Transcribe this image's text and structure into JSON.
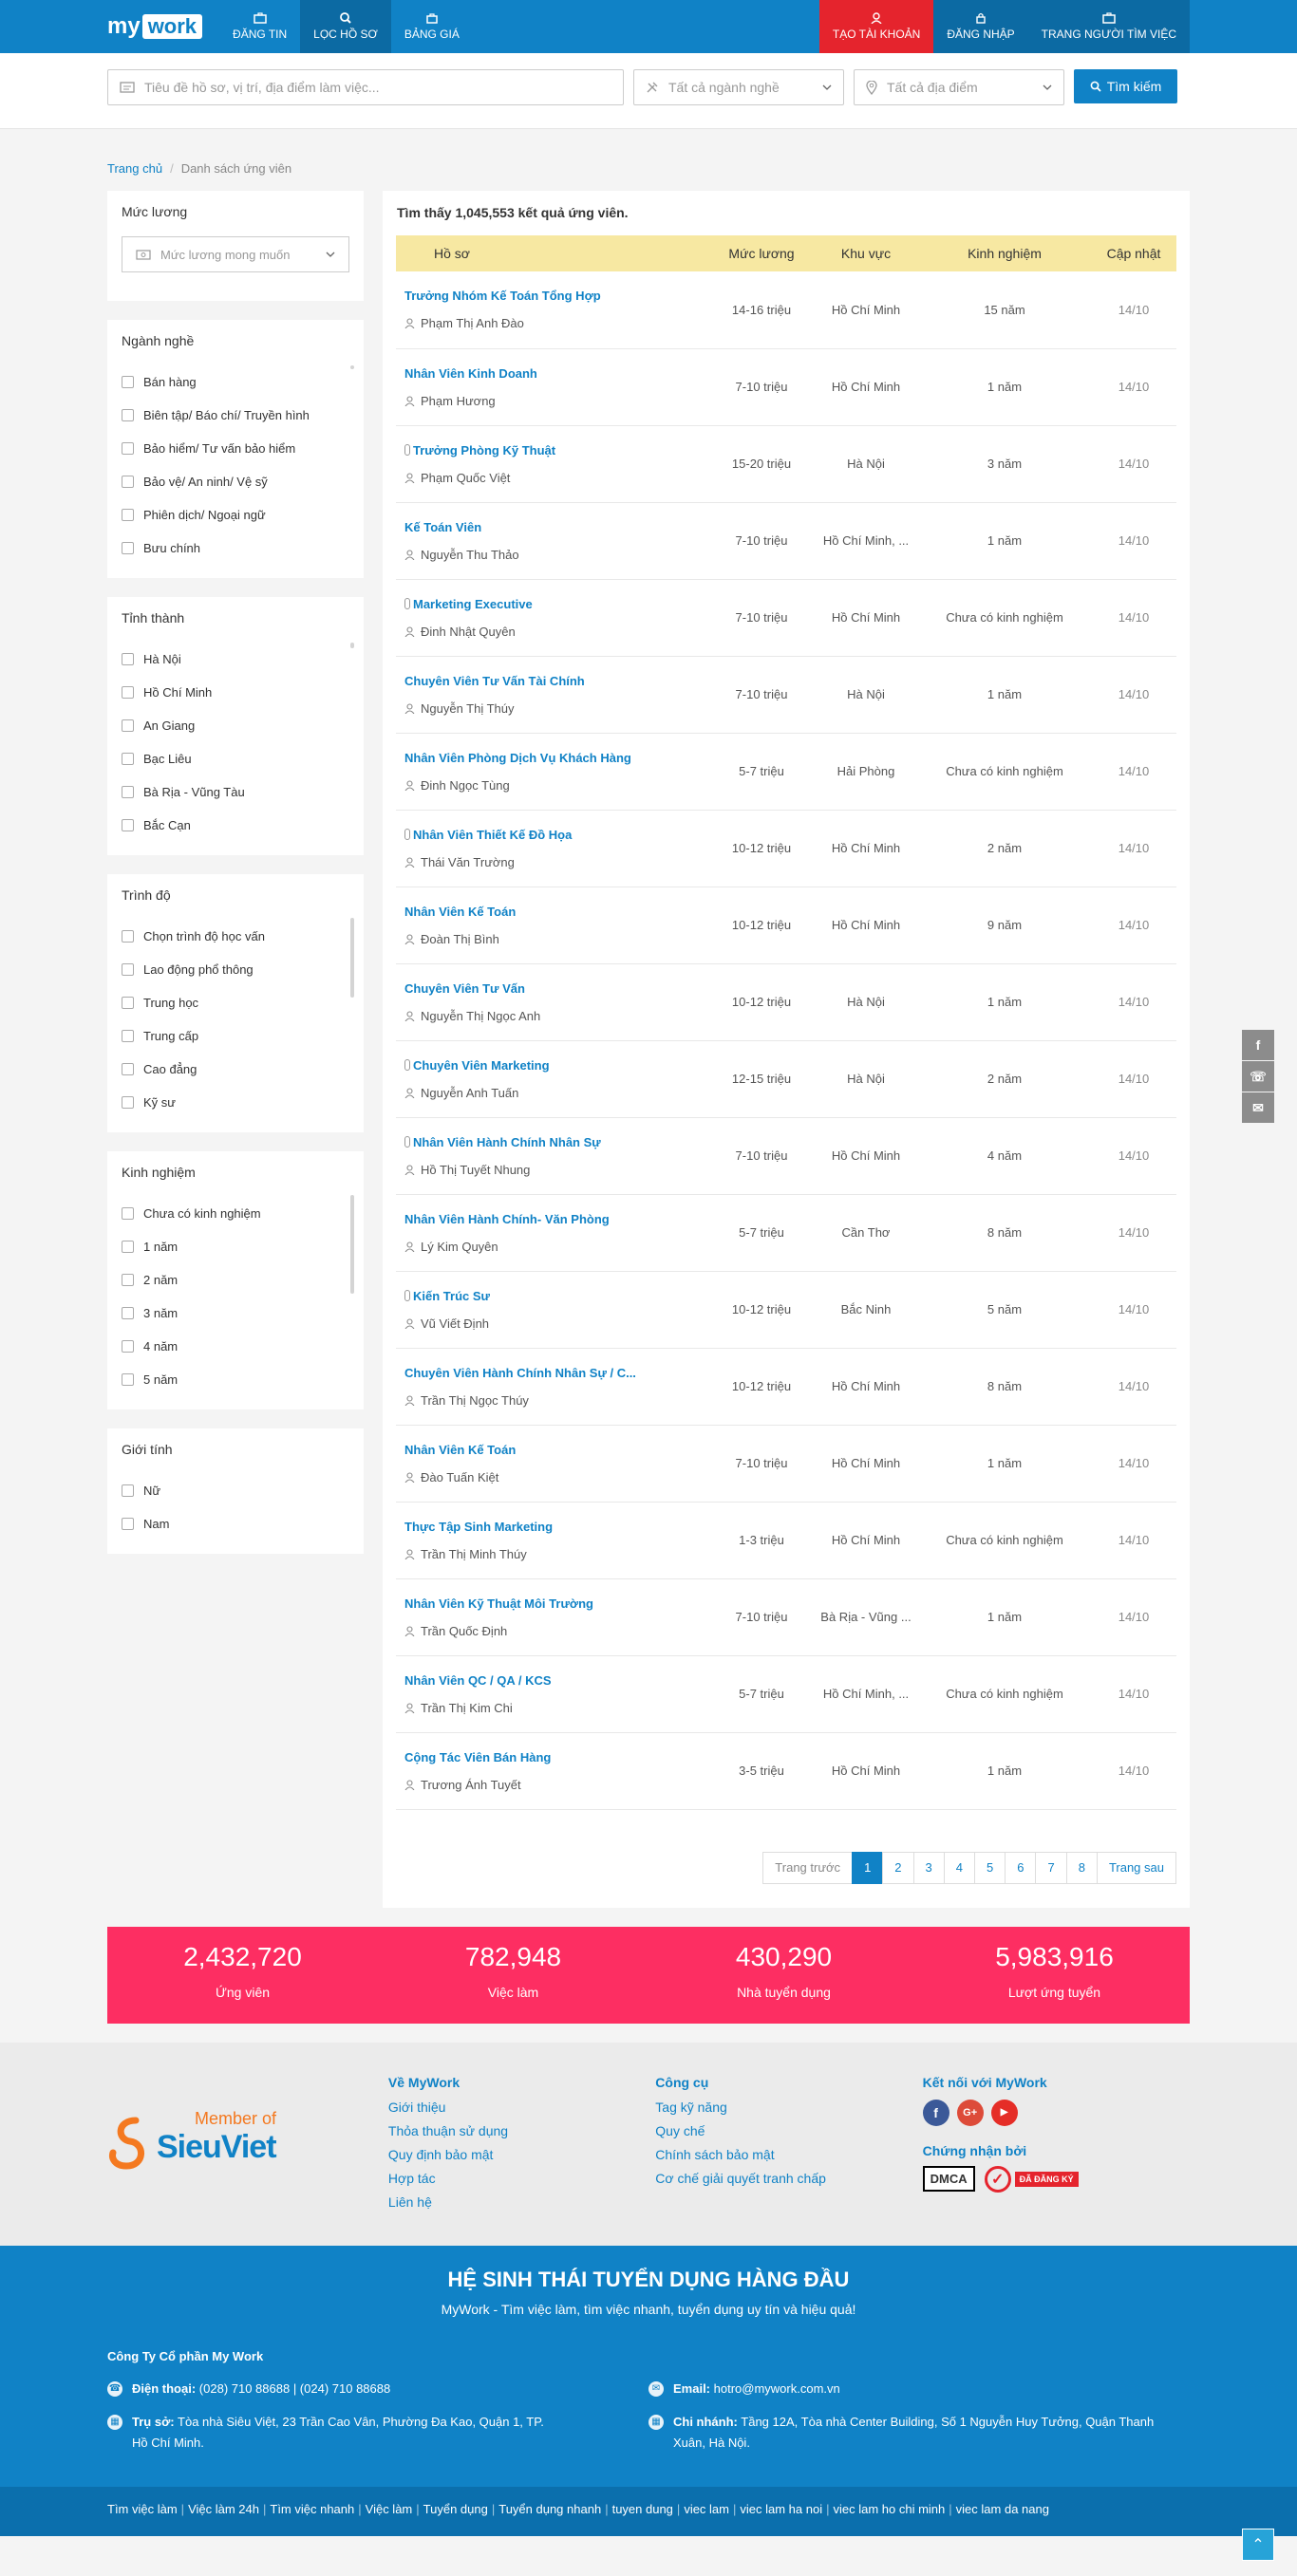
{
  "nav": {
    "logo_my": "my",
    "logo_work": "work",
    "items": [
      "ĐĂNG TIN",
      "LỌC HỒ SƠ",
      "BẢNG GIÁ"
    ],
    "right": [
      "TẠO TÀI KHOẢN",
      "ĐĂNG NHẬP",
      "TRANG NGƯỜI TÌM VIỆC"
    ]
  },
  "search": {
    "keyword_placeholder": "Tiêu đề hồ sơ, vị trí, địa điểm làm việc...",
    "industry": "Tất cả ngành nghề",
    "location": "Tất cả địa điểm",
    "button": "Tìm kiếm"
  },
  "breadcrumb": {
    "home": "Trang chủ",
    "sep": "/",
    "current": "Danh sách ứng viên"
  },
  "sidebar": {
    "salary": {
      "title": "Mức lương",
      "placeholder": "Mức lương mong muốn"
    },
    "industry": {
      "title": "Ngành nghề",
      "items": [
        "Bán hàng",
        "Biên tập/ Báo chí/ Truyền hình",
        "Bảo hiểm/ Tư vấn bảo hiểm",
        "Bảo vệ/ An ninh/ Vệ sỹ",
        "Phiên dịch/ Ngoại ngữ",
        "Bưu chính"
      ]
    },
    "province": {
      "title": "Tỉnh thành",
      "items": [
        "Hà Nội",
        "Hồ Chí Minh",
        "An Giang",
        "Bạc Liêu",
        "Bà Rịa - Vũng Tàu",
        "Bắc Cạn"
      ]
    },
    "level": {
      "title": "Trình độ",
      "items": [
        "Chọn trình độ học vấn",
        "Lao động phổ thông",
        "Trung học",
        "Trung cấp",
        "Cao đẳng",
        "Kỹ sư"
      ]
    },
    "experience": {
      "title": "Kinh nghiệm",
      "items": [
        "Chưa có kinh nghiệm",
        "1 năm",
        "2 năm",
        "3 năm",
        "4 năm",
        "5 năm"
      ]
    },
    "gender": {
      "title": "Giới tính",
      "items": [
        "Nữ",
        "Nam"
      ]
    }
  },
  "results": {
    "found": "Tìm thấy 1,045,553 kết quả ứng viên.",
    "headers": [
      "Hồ sơ",
      "Mức lương",
      "Khu vực",
      "Kinh nghiệm",
      "Cập nhật"
    ],
    "rows": [
      {
        "title": "Trưởng Nhóm Kế Toán Tổng Hợp",
        "name": "Phạm Thị Anh Đào",
        "salary": "14-16 triệu",
        "area": "Hồ Chí Minh",
        "exp": "15 năm",
        "upd": "14/10",
        "clip": false
      },
      {
        "title": "Nhân Viên Kinh Doanh",
        "name": "Phạm Hương",
        "salary": "7-10 triệu",
        "area": "Hồ Chí Minh",
        "exp": "1 năm",
        "upd": "14/10",
        "clip": false
      },
      {
        "title": "Trưởng Phòng Kỹ Thuật",
        "name": "Phạm Quốc Việt",
        "salary": "15-20 triệu",
        "area": "Hà Nội",
        "exp": "3 năm",
        "upd": "14/10",
        "clip": true
      },
      {
        "title": "Kế Toán Viên",
        "name": "Nguyễn Thu Thảo",
        "salary": "7-10 triệu",
        "area": "Hồ Chí Minh, ...",
        "exp": "1 năm",
        "upd": "14/10",
        "clip": false
      },
      {
        "title": "Marketing Executive",
        "name": "Đinh Nhật Quyên",
        "salary": "7-10 triệu",
        "area": "Hồ Chí Minh",
        "exp": "Chưa có kinh nghiệm",
        "upd": "14/10",
        "clip": true
      },
      {
        "title": "Chuyên Viên Tư Vấn Tài Chính",
        "name": "Nguyễn Thị Thúy",
        "salary": "7-10 triệu",
        "area": "Hà Nội",
        "exp": "1 năm",
        "upd": "14/10",
        "clip": false
      },
      {
        "title": "Nhân Viên Phòng Dịch Vụ Khách Hàng",
        "name": "Đinh Ngọc Tùng",
        "salary": "5-7 triệu",
        "area": "Hải Phòng",
        "exp": "Chưa có kinh nghiệm",
        "upd": "14/10",
        "clip": false
      },
      {
        "title": "Nhân Viên Thiết Kế Đồ Họa",
        "name": "Thái Văn Trường",
        "salary": "10-12 triệu",
        "area": "Hồ Chí Minh",
        "exp": "2 năm",
        "upd": "14/10",
        "clip": true
      },
      {
        "title": "Nhân Viên Kế Toán",
        "name": "Đoàn Thị Bình",
        "salary": "10-12 triệu",
        "area": "Hồ Chí Minh",
        "exp": "9 năm",
        "upd": "14/10",
        "clip": false
      },
      {
        "title": "Chuyên Viên Tư Vấn",
        "name": "Nguyễn Thị Ngọc Anh",
        "salary": "10-12 triệu",
        "area": "Hà Nội",
        "exp": "1 năm",
        "upd": "14/10",
        "clip": false
      },
      {
        "title": "Chuyên Viên Marketing",
        "name": "Nguyễn Anh Tuấn",
        "salary": "12-15 triệu",
        "area": "Hà Nội",
        "exp": "2 năm",
        "upd": "14/10",
        "clip": true
      },
      {
        "title": "Nhân Viên Hành Chính Nhân Sự",
        "name": "Hồ Thị Tuyết Nhung",
        "salary": "7-10 triệu",
        "area": "Hồ Chí Minh",
        "exp": "4 năm",
        "upd": "14/10",
        "clip": true
      },
      {
        "title": "Nhân Viên Hành Chính- Văn Phòng",
        "name": "Lý Kim Quyên",
        "salary": "5-7 triệu",
        "area": "Cần Thơ",
        "exp": "8 năm",
        "upd": "14/10",
        "clip": false
      },
      {
        "title": "Kiến Trúc Sư",
        "name": "Vũ Viết Định",
        "salary": "10-12 triệu",
        "area": "Bắc Ninh",
        "exp": "5 năm",
        "upd": "14/10",
        "clip": true
      },
      {
        "title": "Chuyên Viên Hành Chính Nhân Sự / C...",
        "name": "Trần Thị Ngọc Thúy",
        "salary": "10-12 triệu",
        "area": "Hồ Chí Minh",
        "exp": "8 năm",
        "upd": "14/10",
        "clip": false
      },
      {
        "title": "Nhân Viên Kế Toán",
        "name": "Đào Tuấn Kiệt",
        "salary": "7-10 triệu",
        "area": "Hồ Chí Minh",
        "exp": "1 năm",
        "upd": "14/10",
        "clip": false
      },
      {
        "title": "Thực Tập Sinh Marketing",
        "name": "Trần Thị Minh Thúy",
        "salary": "1-3 triệu",
        "area": "Hồ Chí Minh",
        "exp": "Chưa có kinh nghiệm",
        "upd": "14/10",
        "clip": false
      },
      {
        "title": "Nhân Viên Kỹ Thuật Môi Trường",
        "name": "Trần Quốc Định",
        "salary": "7-10 triệu",
        "area": "Bà Rịa - Vũng ...",
        "exp": "1 năm",
        "upd": "14/10",
        "clip": false
      },
      {
        "title": "Nhân Viên QC / QA / KCS",
        "name": "Trần Thị Kim Chi",
        "salary": "5-7 triệu",
        "area": "Hồ Chí Minh, ...",
        "exp": "Chưa có kinh nghiệm",
        "upd": "14/10",
        "clip": false
      },
      {
        "title": "Cộng Tác Viên Bán Hàng",
        "name": "Trương Ánh Tuyết",
        "salary": "3-5 triệu",
        "area": "Hồ Chí Minh",
        "exp": "1 năm",
        "upd": "14/10",
        "clip": false
      }
    ]
  },
  "pagination": {
    "prev": "Trang trước",
    "pages": [
      "1",
      "2",
      "3",
      "4",
      "5",
      "6",
      "7",
      "8"
    ],
    "current": "1",
    "next": "Trang sau"
  },
  "stats": [
    {
      "value": "2,432,720",
      "label": "Ứng viên"
    },
    {
      "value": "782,948",
      "label": "Việc làm"
    },
    {
      "value": "430,290",
      "label": "Nhà tuyển dụng"
    },
    {
      "value": "5,983,916",
      "label": "Lượt ứng tuyển"
    }
  ],
  "footer": {
    "member_of": "Member of",
    "member_brand": "SieuViet",
    "about": {
      "title": "Về MyWork",
      "links": [
        "Giới thiệu",
        "Thỏa thuận sử dụng",
        "Quy định bảo mật",
        "Hợp tác",
        "Liên hệ"
      ]
    },
    "tools": {
      "title": "Công cụ",
      "links": [
        "Tag kỹ năng",
        "Quy chế",
        "Chính sách bảo mật",
        "Cơ chế giải quyết tranh chấp"
      ]
    },
    "connect_title": "Kết nối với MyWork",
    "social": [
      "f",
      "G+",
      "▶"
    ],
    "cert_title": "Chứng nhận bởi",
    "dmca": "DMCA",
    "registered": "ĐÃ ĐĂNG KÝ",
    "eco_title": "HỆ SINH THÁI TUYỂN DỤNG HÀNG ĐẦU",
    "eco_sub": "MyWork - Tìm việc làm, tìm việc nhanh, tuyển dụng uy tín và hiệu quả!",
    "company": "Công Ty Cổ phần My Work",
    "phone_label": "Điện thoại:",
    "phone": "(028) 710 88688 | (024) 710 88688",
    "hq_label": "Trụ sở:",
    "hq": "Tòa nhà Siêu Việt, 23 Trần Cao Vân, Phường Đa Kao, Quận 1, TP. Hồ Chí Minh.",
    "email_label": "Email:",
    "email": "hotro@mywork.com.vn",
    "branch_label": "Chi nhánh:",
    "branch": "Tầng 12A, Tòa nhà Center Building, Số 1 Nguyễn Huy Tưởng, Quận Thanh Xuân, Hà Nội.",
    "bottom_links": [
      "Tìm việc làm",
      "Việc làm 24h",
      "Tìm việc nhanh",
      "Việc làm",
      "Tuyển dụng",
      "Tuyển dụng nhanh",
      "tuyen dung",
      "viec lam",
      "viec lam ha noi",
      "viec lam ho chi minh",
      "viec lam da nang"
    ]
  }
}
